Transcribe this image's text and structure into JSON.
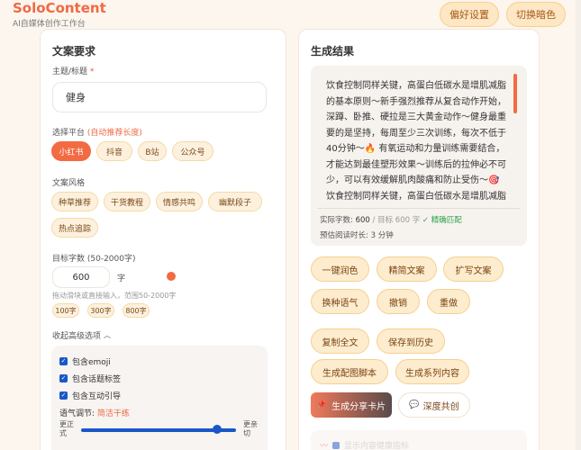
{
  "header": {
    "brand": "SoloContent",
    "subtitle": "AI自媒体创作工作台",
    "prefs_button": "偏好设置",
    "theme_button": "切换暗色"
  },
  "left": {
    "title": "文案要求",
    "topic_label": "主题/标题",
    "required_mark": "*",
    "topic_value": "健身",
    "platform_label": "选择平台",
    "platform_hint": "(自动推荐长度)",
    "platforms": [
      "小红书",
      "抖音",
      "B站",
      "公众号"
    ],
    "style_label": "文案风格",
    "styles": [
      "种草推荐",
      "干货教程",
      "情感共鸣",
      "幽默段子",
      "热点追踪"
    ],
    "word_label": "目标字数 (50-2000字)",
    "word_value": "600",
    "word_unit": "字",
    "word_hint": "拖动滑块或直接输入，范围50-2000字",
    "presets": [
      "100字",
      "300字",
      "800字"
    ],
    "advanced_toggle": "收起高级选项",
    "opt_emoji": "包含emoji",
    "opt_tags": "包含话题标签",
    "opt_cta": "包含互动引导",
    "tone_label": "语气调节:",
    "tone_value": "简洁干练",
    "tone_left": "更正式",
    "tone_right": "更亲切",
    "tone_level_percent": 88
  },
  "right": {
    "title": "生成结果",
    "result_text": "饮食控制同样关键，高蛋白低碳水是增肌减脂的基本原则～新手强烈推荐从复合动作开始，深蹲、卧推、硬拉是三大黄金动作～健身最重要的是坚持，每周至少三次训练，每次不低于40分钟～🔥 有氧运动和力量训练需要结合，才能达到最佳塑形效果～训练后的拉伸必不可少，可以有效缓解肌肉酸痛和防止受伤～🎯 饮食控制同样关键，高蛋白低碳水是增肌减脂的基本原则～新手强烈推荐从复合动作开始，深蹲",
    "actual_label": "实际字数:",
    "actual_value": "600",
    "target_label": "/ 目标 600 字",
    "match_text": "✓ 精确匹配",
    "read_label": "预估阅读时长:",
    "read_value": "3 分钟",
    "actions_row1": [
      "一键润色",
      "精简文案",
      "扩写文案"
    ],
    "actions_row2": [
      "换种语气",
      "撤销",
      "重做"
    ],
    "actions_row3": [
      "复制全文",
      "保存到历史"
    ],
    "actions_row4": [
      "生成配图脚本",
      "生成系列内容"
    ],
    "share_card": "生成分享卡片",
    "co_create": "深度共创",
    "bottom_faded": "显示内容健康指标"
  },
  "colors": {
    "accent": "#f26b43",
    "chip_bg": "#fdf1de",
    "page_bg": "#fdf6ee"
  }
}
